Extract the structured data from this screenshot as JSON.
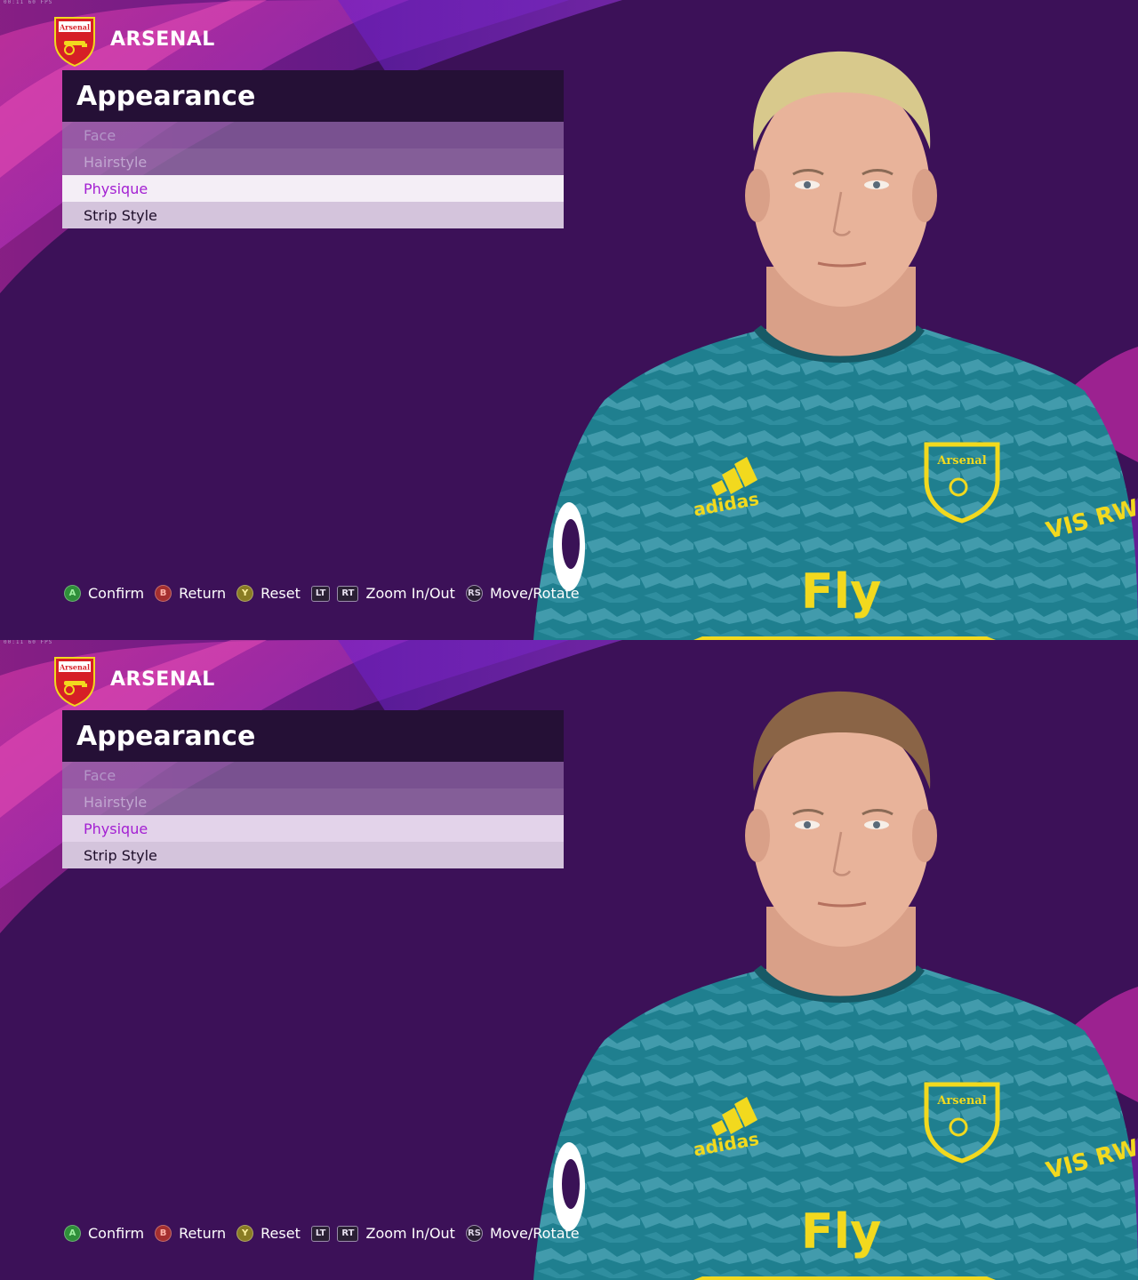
{
  "screens": [
    {
      "fps_overlay": "00:11   60 FPS",
      "club": {
        "name": "ARSENAL",
        "crest_text": "Arsenal"
      },
      "menu": {
        "title": "Appearance",
        "items": [
          "Face",
          "Hairstyle",
          "Physique",
          "Strip Style"
        ],
        "selected": "Physique"
      },
      "player": {
        "hair_color": "#d8c98c",
        "skin_color": "#e8b39a",
        "shirt_color": "#1f7f8f"
      },
      "hints": [
        {
          "button": "A",
          "label": "Confirm"
        },
        {
          "button": "B",
          "label": "Return"
        },
        {
          "button": "Y",
          "label": "Reset"
        },
        {
          "button": "LT",
          "label": ""
        },
        {
          "button": "RT",
          "label": "Zoom In/Out"
        },
        {
          "button": "RS",
          "label": "Move/Rotate"
        }
      ]
    },
    {
      "fps_overlay": "00:11   60 FPS",
      "club": {
        "name": "ARSENAL",
        "crest_text": "Arsenal"
      },
      "menu": {
        "title": "Appearance",
        "items": [
          "Face",
          "Hairstyle",
          "Physique",
          "Strip Style"
        ],
        "selected": "Physique"
      },
      "player": {
        "hair_color": "#8a6446",
        "skin_color": "#e8b39a",
        "shirt_color": "#1f7f8f"
      },
      "hints": [
        {
          "button": "A",
          "label": "Confirm"
        },
        {
          "button": "B",
          "label": "Return"
        },
        {
          "button": "Y",
          "label": "Reset"
        },
        {
          "button": "LT",
          "label": ""
        },
        {
          "button": "RT",
          "label": "Zoom In/Out"
        },
        {
          "button": "RS",
          "label": "Move/Rotate"
        }
      ]
    }
  ],
  "kit_text": {
    "sponsor": "Fly",
    "brand": "adidas",
    "sleeve": "VIS RWA"
  },
  "colors": {
    "background": "#3c1158",
    "accent_pink": "#d02aa8",
    "accent_purple": "#7a2bd0",
    "selected_text": "#a31fd2",
    "kit_yellow": "#f2d91e"
  }
}
